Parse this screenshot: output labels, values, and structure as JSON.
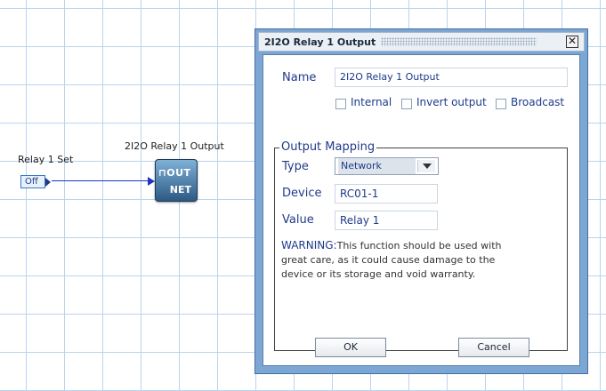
{
  "canvas": {
    "input_label": "Relay 1 Set",
    "input_value": "Off",
    "output_label": "2I2O Relay 1 Output",
    "node_top": "⊓OUT",
    "node_bottom": "NET"
  },
  "dialog": {
    "title": "2I2O Relay 1 Output",
    "close_icon": "close-icon",
    "name_label": "Name",
    "name_value": "2I2O Relay 1 Output",
    "internal_label": "Internal",
    "invert_label": "Invert output",
    "broadcast_label": "Broadcast",
    "mapping_legend": "Output Mapping",
    "type_label": "Type",
    "type_value": "Network",
    "device_label": "Device",
    "device_value": "RC01-1",
    "value_label": "Value",
    "value_value": "Relay 1",
    "warning_head": "WARNING:",
    "warning_body": "This function should be used with great care, as it could cause damage to the device or its storage and void warranty.",
    "ok_label": "OK",
    "cancel_label": "Cancel"
  }
}
